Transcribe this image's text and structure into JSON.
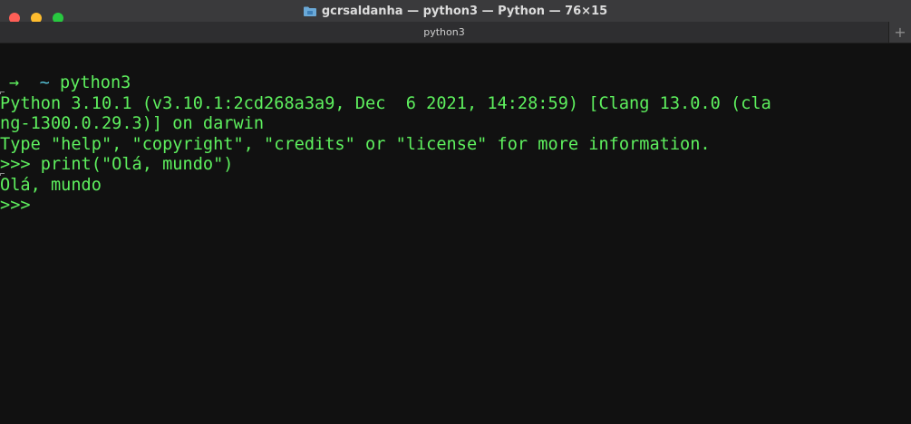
{
  "window": {
    "title": "gcrsaldanha — python3 — Python — 76×15",
    "folder_icon": "folder-icon",
    "buttons": {
      "close": "close-icon",
      "minimize": "minimize-icon",
      "maximize": "maximize-icon"
    }
  },
  "tabs": [
    {
      "label": "python3"
    }
  ],
  "new_tab": {
    "label": "+"
  },
  "terminal": {
    "prompt": {
      "arrow": "→",
      "tilde": "~",
      "command": "python3"
    },
    "lines": [
      "Python 3.10.1 (v3.10.1:2cd268a3a9, Dec  6 2021, 14:28:59) [Clang 13.0.0 (cla",
      "ng-1300.0.29.3)] on darwin",
      "Type \"help\", \"copyright\", \"credits\" or \"license\" for more information.",
      ">>> print(\"Olá, mundo\")",
      "Olá, mundo",
      ">>> "
    ]
  },
  "colors": {
    "text": "#5ef05e",
    "tilde": "#56c1d6",
    "background": "#111111",
    "titlebar": "#3a3a3c"
  }
}
